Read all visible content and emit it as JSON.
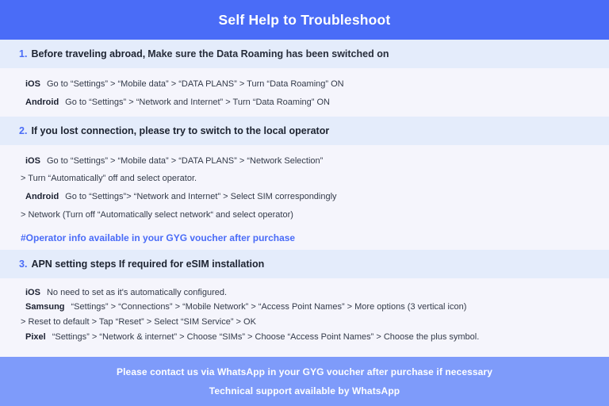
{
  "header": {
    "title": "Self Help to Troubleshoot"
  },
  "sections": [
    {
      "number": "1.",
      "heading_strong": "Before traveling abroad,",
      "heading_rest": "Make sure the Data Roaming has been switched on",
      "rows": [
        {
          "os": "iOS",
          "text": "Go to “Settings” > “Mobile data” > “DATA PLANS” > Turn “Data Roaming” ON"
        },
        {
          "os": "Android",
          "text": "Go to “Settings” > “Network and Internet” > Turn “Data Roaming” ON"
        }
      ]
    },
    {
      "number": "2.",
      "heading_strong": "If you lost connection, please try to switch to the local operator",
      "heading_rest": "",
      "rows": [
        {
          "os": "iOS",
          "text": "Go to “Settings” > “Mobile data” > “DATA PLANS” > “Network Selection”"
        },
        {
          "os": "",
          "text": "> Turn “Automatically” off and select operator."
        },
        {
          "os": "Android",
          "text": "Go to “Settings”>  “Network and Internet” > Select SIM correspondingly"
        },
        {
          "os": "",
          "text": "> Network (Turn off “Automatically select network“ and select operator)"
        }
      ],
      "note": "#Operator info available in your GYG voucher after purchase"
    },
    {
      "number": "3.",
      "heading_strong": "APN setting steps If required for eSIM installation",
      "heading_rest": "",
      "rows": [
        {
          "os": "iOS",
          "text": "No need to set as it's automatically configured."
        },
        {
          "os": "Samsung",
          "text": "“Settings” > “Connections” > “Mobile Network” > “Access Point Names” > More options (3 vertical icon)"
        },
        {
          "os": "",
          "text": "> Reset to default > Tap “Reset” > Select “SIM Service” > OK"
        },
        {
          "os": "Pixel",
          "text": "“Settings” > “Network & internet” > Choose “SIMs” > Choose “Access Point Names” > Choose the plus symbol."
        }
      ]
    }
  ],
  "footer": {
    "line1": "Please contact us via WhatsApp  in your GYG voucher after purchase if necessary",
    "line2": "Technical support available by WhatsApp"
  },
  "colors": {
    "header_blue": "#4a6cf7",
    "footer_blue": "#7e9bfa",
    "band_blue": "#e4ecfb",
    "page_bg": "#f5f5fc",
    "accent_text": "#4a6cf7"
  }
}
